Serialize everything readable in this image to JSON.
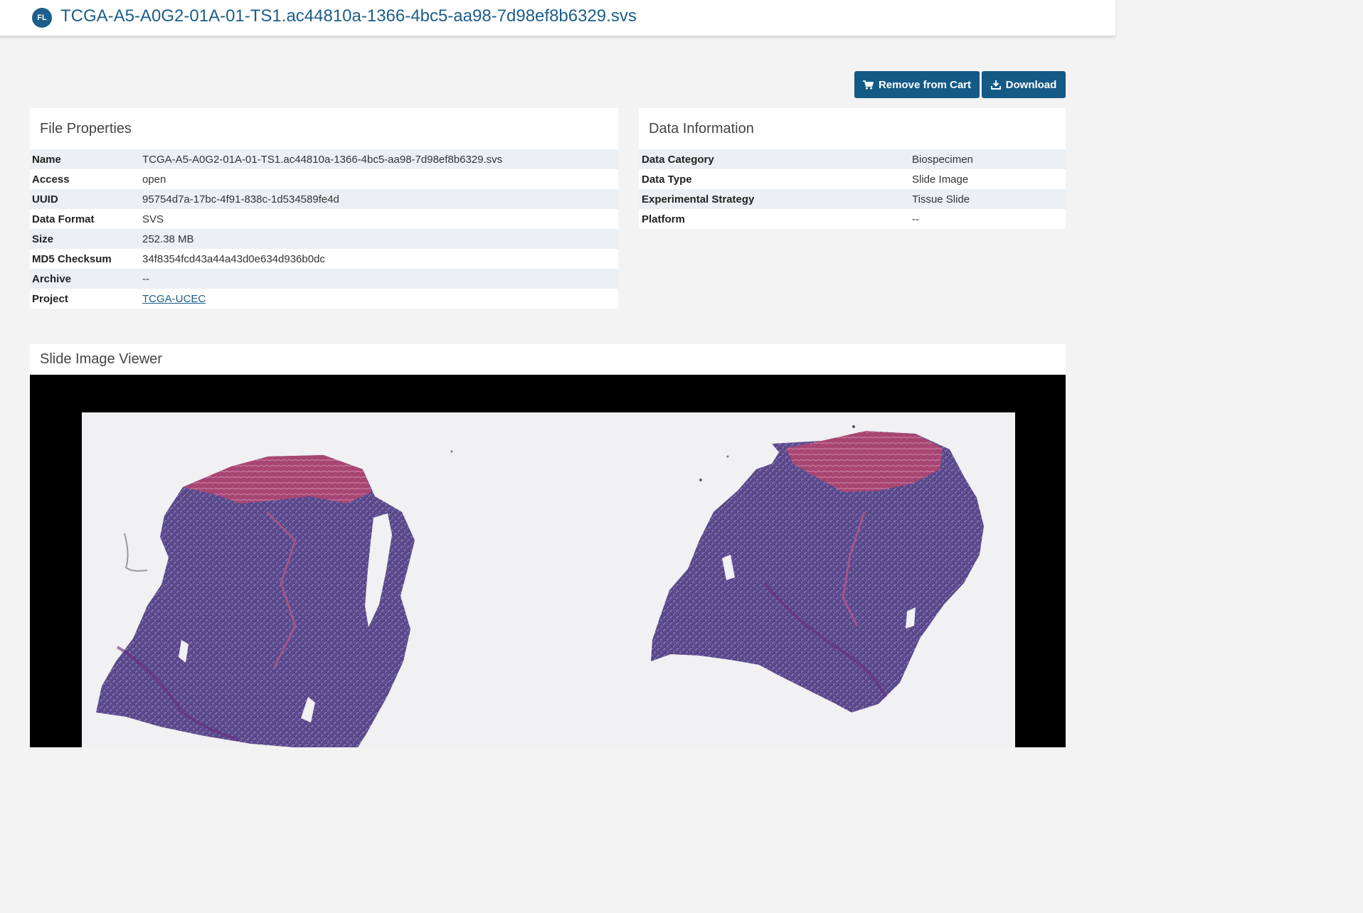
{
  "header": {
    "badge": "FL",
    "title": "TCGA-A5-A0G2-01A-01-TS1.ac44810a-1366-4bc5-aa98-7d98ef8b6329.svs"
  },
  "actions": {
    "remove_label": "Remove from Cart",
    "download_label": "Download"
  },
  "file_properties": {
    "title": "File Properties",
    "rows": [
      {
        "key": "Name",
        "value": "TCGA-A5-A0G2-01A-01-TS1.ac44810a-1366-4bc5-aa98-7d98ef8b6329.svs"
      },
      {
        "key": "Access",
        "value": "open"
      },
      {
        "key": "UUID",
        "value": "95754d7a-17bc-4f91-838c-1d534589fe4d"
      },
      {
        "key": "Data Format",
        "value": "SVS"
      },
      {
        "key": "Size",
        "value": "252.38 MB"
      },
      {
        "key": "MD5 Checksum",
        "value": "34f8354fcd43a44a43d0e634d936b0dc"
      },
      {
        "key": "Archive",
        "value": "--"
      },
      {
        "key": "Project",
        "value": "TCGA-UCEC"
      }
    ]
  },
  "data_information": {
    "title": "Data Information",
    "rows": [
      {
        "key": "Data Category",
        "value": "Biospecimen"
      },
      {
        "key": "Data Type",
        "value": "Slide Image"
      },
      {
        "key": "Experimental Strategy",
        "value": "Tissue Slide"
      },
      {
        "key": "Platform",
        "value": "--"
      }
    ]
  },
  "viewer": {
    "title": "Slide Image Viewer"
  },
  "colors": {
    "brand": "#1b5e8a",
    "button": "#145a86",
    "tissue_primary": "#5a4a8c",
    "tissue_stroma": "#b0446f"
  }
}
